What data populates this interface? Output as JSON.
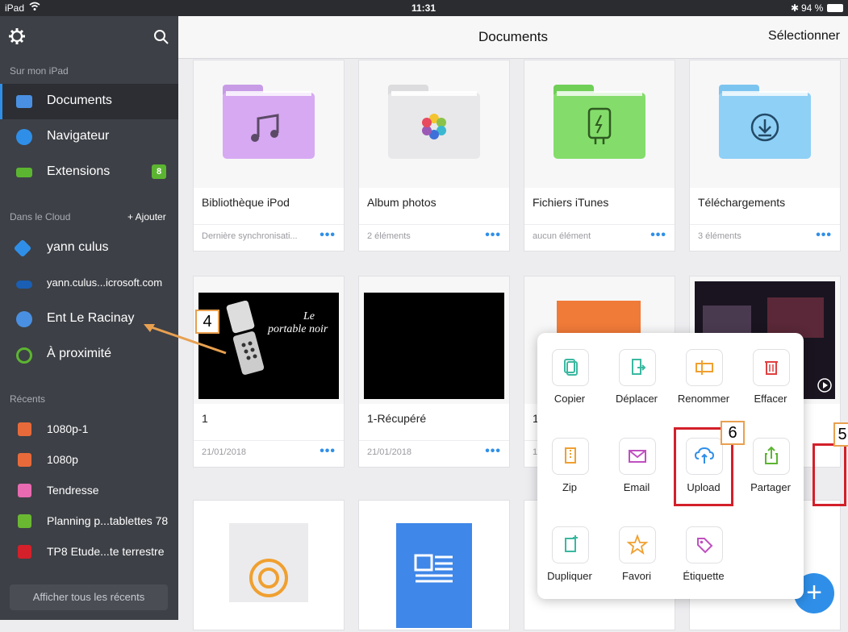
{
  "status": {
    "device": "iPad",
    "time": "11:31",
    "battery": "94 %"
  },
  "sidebar": {
    "section_local": "Sur mon iPad",
    "items": [
      {
        "label": "Documents",
        "icon": "folder-icon",
        "color": "#4a90e2"
      },
      {
        "label": "Navigateur",
        "icon": "compass-icon",
        "color": "#2f8fe8"
      },
      {
        "label": "Extensions",
        "icon": "cart-icon",
        "color": "#5cb531",
        "badge": "8"
      }
    ],
    "section_cloud": "Dans le Cloud",
    "add_label": "+ Ajouter",
    "cloud_items": [
      {
        "label": "yann culus",
        "icon": "dropbox-icon",
        "color": "#2f8fe8"
      },
      {
        "label": "yann.culus...icrosoft.com",
        "icon": "onedrive-icon",
        "color": "#1a5fb4"
      },
      {
        "label": "Ent Le Racinay",
        "icon": "globe-icon",
        "color": "#4a90e2"
      },
      {
        "label": "À proximité",
        "icon": "nearby-icon",
        "color": "#5cb531"
      }
    ],
    "section_recent": "Récents",
    "recents": [
      {
        "label": "1080p-1",
        "icon": "video-icon",
        "color": "#e86a3a"
      },
      {
        "label": "1080p",
        "icon": "video-icon",
        "color": "#e86a3a"
      },
      {
        "label": "Tendresse",
        "icon": "music-icon",
        "color": "#e86ab0"
      },
      {
        "label": "Planning p...tablettes 78",
        "icon": "sheet-icon",
        "color": "#6ab832"
      },
      {
        "label": "TP8 Etude...te terrestre",
        "icon": "pdf-icon",
        "color": "#d3202a"
      }
    ],
    "show_all_recents": "Afficher tous les récents"
  },
  "navbar": {
    "title": "Documents",
    "select": "Sélectionner"
  },
  "cards": [
    {
      "name": "Bibliothèque iPod",
      "sub": "Dernière synchronisati..."
    },
    {
      "name": "Album photos",
      "sub": "2 éléments"
    },
    {
      "name": "Fichiers iTunes",
      "sub": "aucun élément"
    },
    {
      "name": "Téléchargements",
      "sub": "3 éléments"
    },
    {
      "name": "1",
      "sub": "21/01/2018",
      "thumb_text_1": "Le",
      "thumb_text_2": "portable noir"
    },
    {
      "name": "1-Récupéré",
      "sub": "21/01/2018"
    },
    {
      "name": "1",
      "sub": "1"
    }
  ],
  "menu": {
    "items": [
      {
        "label": "Copier",
        "icon": "copy-icon",
        "color": "#3bb8a0"
      },
      {
        "label": "Déplacer",
        "icon": "move-icon",
        "color": "#3bb8a0"
      },
      {
        "label": "Renommer",
        "icon": "rename-icon",
        "color": "#f0a030"
      },
      {
        "label": "Effacer",
        "icon": "trash-icon",
        "color": "#e04040"
      },
      {
        "label": "Zip",
        "icon": "zip-icon",
        "color": "#f0a030"
      },
      {
        "label": "Email",
        "icon": "mail-icon",
        "color": "#c050c0"
      },
      {
        "label": "Upload",
        "icon": "cloud-upload-icon",
        "color": "#2f8fe8"
      },
      {
        "label": "Partager",
        "icon": "share-icon",
        "color": "#5cb531"
      },
      {
        "label": "Dupliquer",
        "icon": "duplicate-icon",
        "color": "#3bb8a0"
      },
      {
        "label": "Favori",
        "icon": "star-icon",
        "color": "#f0a030"
      },
      {
        "label": "Étiquette",
        "icon": "tag-icon",
        "color": "#c050c0"
      }
    ]
  },
  "callouts": {
    "c4": "4",
    "c5": "5",
    "c6": "6"
  }
}
